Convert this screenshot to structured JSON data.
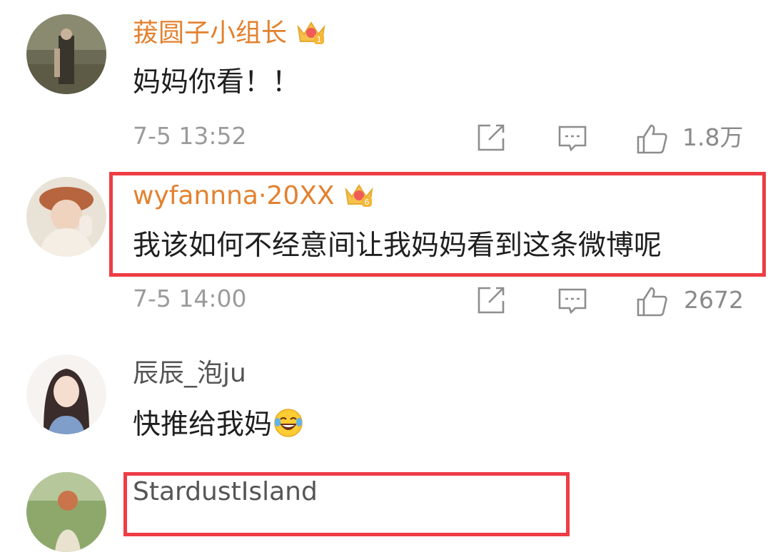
{
  "comments": [
    {
      "username": "菝圆子小组长",
      "text": "妈妈你看！！",
      "time": "7-5 13:52",
      "likes": "1.8万",
      "badge_level": "1"
    },
    {
      "username": "wyfannna·20XX",
      "text": "我该如何不经意间让我妈妈看到这条微博呢",
      "time": "7-5 14:00",
      "likes": "2672",
      "badge_level": "6"
    },
    {
      "username": "辰辰_泡ju",
      "text": "快推给我妈"
    },
    {
      "username": "StardustIsland"
    }
  ],
  "icons": {
    "share": "share-icon",
    "comment": "comment-icon",
    "like": "thumbs-up-icon",
    "vip_badge": "crown-badge-icon",
    "emoji": "laughing-tears-emoji"
  },
  "colors": {
    "username_vip": "#e3812f",
    "username_plain": "#555555",
    "text": "#1f1f1f",
    "meta": "#9b9b9b",
    "highlight": "#ee3c45"
  }
}
